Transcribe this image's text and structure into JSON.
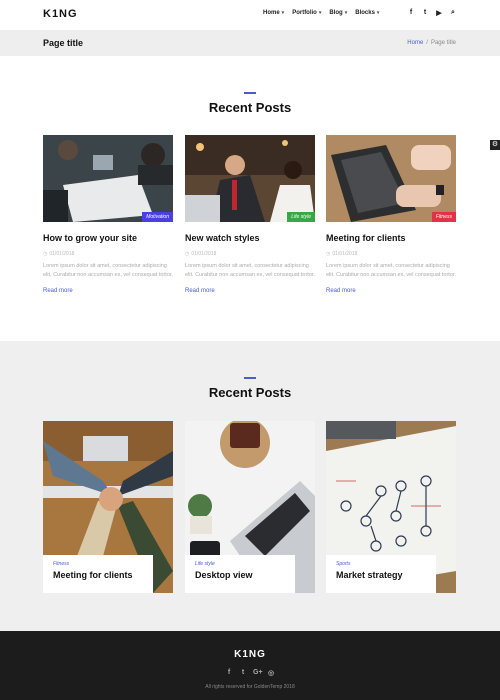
{
  "header": {
    "logo": "K1NG",
    "nav": [
      {
        "label": "Home"
      },
      {
        "label": "Portfolio"
      },
      {
        "label": "Blog"
      },
      {
        "label": "Blocks"
      }
    ],
    "social_icons": [
      {
        "name": "facebook-icon",
        "glyph": "f"
      },
      {
        "name": "twitter-icon",
        "glyph": "t"
      },
      {
        "name": "youtube-icon",
        "glyph": "▶"
      },
      {
        "name": "search-icon",
        "glyph": "⌕"
      }
    ]
  },
  "titlebar": {
    "page_title": "Page title",
    "breadcrumb_home": "Home",
    "breadcrumb_sep": "/",
    "breadcrumb_current": "Page title"
  },
  "section1": {
    "title": "Recent Posts",
    "posts": [
      {
        "title": "How to grow your site",
        "badge": "Motivation",
        "badge_color": "#4a3fe0",
        "date": "01/01/2018",
        "excerpt": "Lorem ipsum dolor sit amet, consectetur adipiscing elit. Curabitur non accumsan ex, vel consequat tortor.",
        "more": "Read more"
      },
      {
        "title": "New watch styles",
        "badge": "Life style",
        "badge_color": "#37a84a",
        "date": "01/01/2018",
        "excerpt": "Lorem ipsum dolor sit amet, consectetur adipiscing elit. Curabitur non accumsan ex, vel consequat tortor.",
        "more": "Read more"
      },
      {
        "title": "Meeting for clients",
        "badge": "Fitness",
        "badge_color": "#e0334a",
        "date": "01/01/2018",
        "excerpt": "Lorem ipsum dolor sit amet, consectetur adipiscing elit. Curabitur non accumsan ex, vel consequat tortor.",
        "more": "Read more"
      }
    ]
  },
  "section2": {
    "title": "Recent Posts",
    "posts": [
      {
        "category": "Fitness",
        "title": "Meeting for clients"
      },
      {
        "category": "Life style",
        "title": "Desktop view"
      },
      {
        "category": "Sports",
        "title": "Market strategy"
      }
    ]
  },
  "footer": {
    "logo": "K1NG",
    "social_icons": [
      {
        "name": "facebook-icon",
        "glyph": "f"
      },
      {
        "name": "twitter-icon",
        "glyph": "t"
      },
      {
        "name": "google-plus-icon",
        "glyph": "G+"
      },
      {
        "name": "instagram-icon",
        "glyph": "◎"
      }
    ],
    "copyright": "All rights reserved for GoldenTemp 2018"
  },
  "colors": {
    "accent": "#4a5bd4",
    "footer_bg": "#1c1c1c",
    "section_bg": "#efefef"
  }
}
